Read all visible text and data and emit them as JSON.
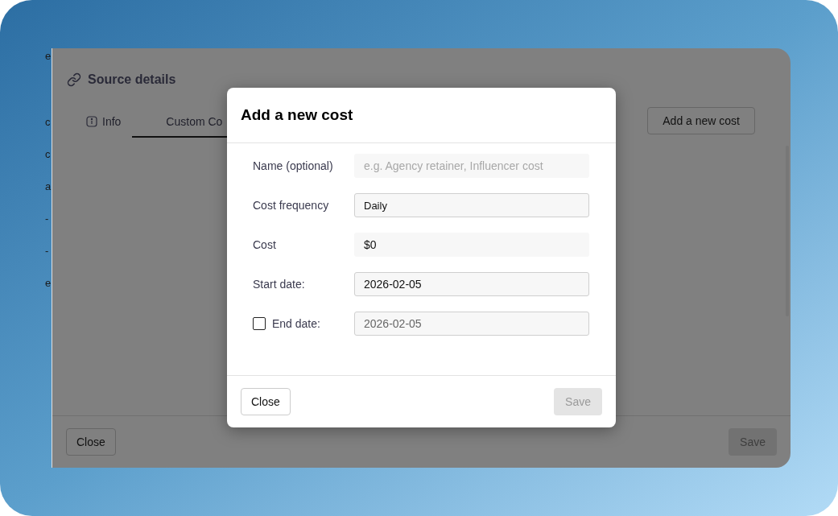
{
  "backdrop_fragments": [
    "e",
    "c",
    "c",
    "a",
    "-",
    "-",
    "e"
  ],
  "window": {
    "title": "Source details",
    "tabs": [
      {
        "label": "Info",
        "selected": false,
        "kind": "info"
      },
      {
        "label": "Custom Co",
        "selected": true,
        "kind": "plain"
      }
    ],
    "add_button": "Add a new cost",
    "close": "Close",
    "save": {
      "label": "Save",
      "disabled": true
    }
  },
  "dialog": {
    "title": "Add a new cost",
    "fields": [
      {
        "kind": "text",
        "label": "Name (optional)",
        "placeholder": "e.g. Agency retainer, Influencer cost"
      },
      {
        "kind": "select",
        "label": "Cost frequency",
        "value": "Daily"
      },
      {
        "kind": "text",
        "label": "Cost",
        "value": "$0"
      },
      {
        "kind": "date",
        "label": "Start date:",
        "value": "2026-02-05"
      },
      {
        "kind": "date",
        "label": "End date:",
        "value": "2026-02-05",
        "checked": false,
        "disabled": true
      }
    ],
    "close": "Close",
    "save": {
      "label": "Save",
      "disabled": true
    }
  }
}
